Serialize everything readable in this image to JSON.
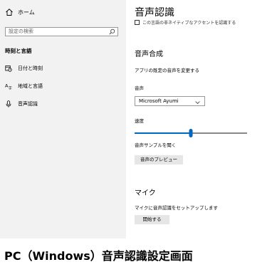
{
  "sidebar": {
    "home_label": "ホーム",
    "search_placeholder": "設定の検索",
    "category": "時刻と言語",
    "items": [
      {
        "label": "日付と時刻",
        "icon": "calendar-clock-icon"
      },
      {
        "label": "地域と言語",
        "icon": "language-icon"
      },
      {
        "label": "音声認識",
        "icon": "microphone-icon"
      }
    ]
  },
  "main": {
    "title": "音声認識",
    "clipped_text": "この言語の非ネイティブなアクセントを認識する",
    "voice_section": {
      "heading": "音声合成",
      "description": "アプリの既定の音声を変更する",
      "voice_label": "音声",
      "voice_value": "Microsoft Ayumi",
      "speed_label": "速度",
      "speed_level": 0.5,
      "sample_label": "音声サンプルを聞く",
      "preview_button": "音声のプレビュー"
    },
    "mic_section": {
      "heading": "マイク",
      "description": "マイクに音声認識をセットアップします",
      "start_button": "開始する"
    }
  },
  "caption": "PC（Windows）音声認識設定画面",
  "colors": {
    "accent": "#0067c0",
    "sidebar_bg": "#f2f2f2",
    "button_bg": "#e6e6e6"
  }
}
